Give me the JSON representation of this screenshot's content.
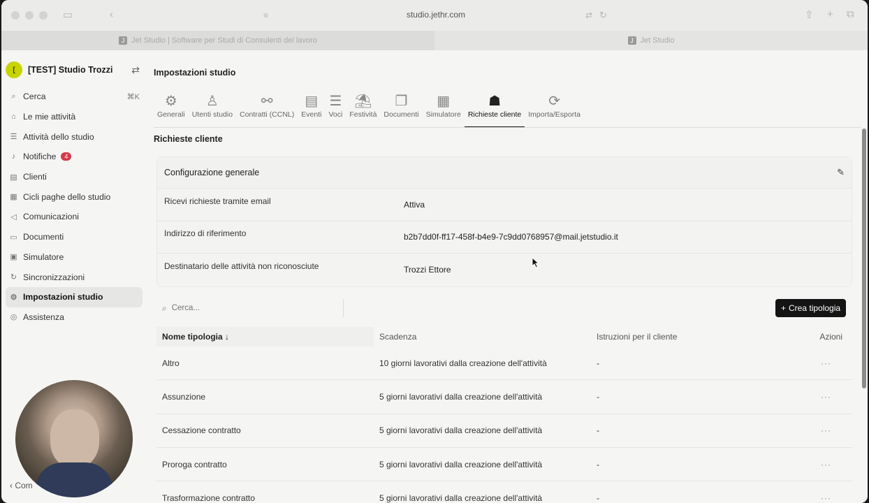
{
  "browser": {
    "url": "studio.jethr.com",
    "tabs": [
      {
        "title": "Jet Studio | Software per Studi di Consulenti del lavoro"
      },
      {
        "title": "Jet Studio"
      }
    ]
  },
  "sidebar": {
    "workspace_initial": "[",
    "workspace_name": "[TEST] Studio Trozzi",
    "items": [
      {
        "label": "Cerca",
        "icon": "search-icon",
        "shortcut": "⌘K"
      },
      {
        "label": "Le mie attività",
        "icon": "home-icon"
      },
      {
        "label": "Attività dello studio",
        "icon": "list-icon"
      },
      {
        "label": "Notifiche",
        "icon": "bell-icon",
        "badge": "4"
      },
      {
        "label": "Clienti",
        "icon": "clients-icon"
      },
      {
        "label": "Cicli paghe dello studio",
        "icon": "cycle-icon"
      },
      {
        "label": "Comunicazioni",
        "icon": "megaphone-icon"
      },
      {
        "label": "Documenti",
        "icon": "folder-icon"
      },
      {
        "label": "Simulatore",
        "icon": "calculator-icon"
      },
      {
        "label": "Sincronizzazioni",
        "icon": "sync-icon"
      },
      {
        "label": "Impostazioni studio",
        "icon": "gear-icon",
        "active": true
      },
      {
        "label": "Assistenza",
        "icon": "help-icon"
      }
    ],
    "bottom_label": "Com"
  },
  "main": {
    "page_title": "Impostazioni studio",
    "tabs": [
      {
        "label": "Generali",
        "icon": "gear-icon"
      },
      {
        "label": "Utenti studio",
        "icon": "user-icon"
      },
      {
        "label": "Contratti (CCNL)",
        "icon": "handshake-icon"
      },
      {
        "label": "Eventi",
        "icon": "calendar-icon"
      },
      {
        "label": "Voci",
        "icon": "list-icon"
      },
      {
        "label": "Festività",
        "icon": "beach-icon"
      },
      {
        "label": "Documenti",
        "icon": "documents-icon"
      },
      {
        "label": "Simulatore",
        "icon": "calculator-icon"
      },
      {
        "label": "Richieste cliente",
        "icon": "people-icon",
        "active": true
      },
      {
        "label": "Importa/Esporta",
        "icon": "sync-icon"
      }
    ],
    "section_title": "Richieste cliente",
    "config": {
      "title": "Configurazione generale",
      "rows": [
        {
          "key": "Ricevi richieste tramite email",
          "value": "Attiva"
        },
        {
          "key": "Indirizzo di riferimento",
          "value": "b2b7dd0f-ff17-458f-b4e9-7c9dd0768957@mail.jetstudio.it"
        },
        {
          "key": "Destinatario delle attività non riconosciute",
          "value": "Trozzi Ettore"
        }
      ]
    },
    "search_placeholder": "Cerca...",
    "create_button": "Crea tipologia",
    "table": {
      "headers": [
        "Nome tipologia",
        "Scadenza",
        "Istruzioni per il cliente",
        "Azioni"
      ],
      "rows": [
        {
          "name": "Altro",
          "deadline": "10 giorni lavorativi dalla creazione dell'attività",
          "instructions": "-",
          "actions": "···"
        },
        {
          "name": "Assunzione",
          "deadline": "5 giorni lavorativi dalla creazione dell'attività",
          "instructions": "-",
          "actions": "···"
        },
        {
          "name": "Cessazione contratto",
          "deadline": "5 giorni lavorativi dalla creazione dell'attività",
          "instructions": "-",
          "actions": "···"
        },
        {
          "name": "Proroga contratto",
          "deadline": "5 giorni lavorativi dalla creazione dell'attività",
          "instructions": "-",
          "actions": "···"
        },
        {
          "name": "Trasformazione contratto",
          "deadline": "5 giorni lavorativi dalla creazione dell'attività",
          "instructions": "-",
          "actions": "···"
        }
      ]
    }
  }
}
